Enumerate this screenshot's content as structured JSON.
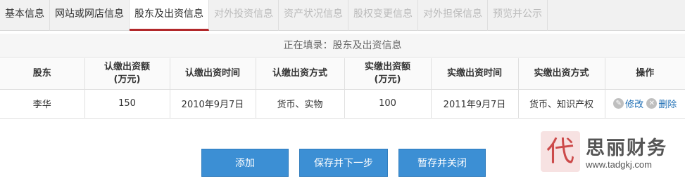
{
  "tabs": [
    {
      "label": "基本信息",
      "state": "done"
    },
    {
      "label": "网站或网店信息",
      "state": "done"
    },
    {
      "label": "股东及出资信息",
      "state": "active"
    },
    {
      "label": "对外投资信息",
      "state": "pending"
    },
    {
      "label": "资产状况信息",
      "state": "pending"
    },
    {
      "label": "股权变更信息",
      "state": "pending"
    },
    {
      "label": "对外担保信息",
      "state": "pending"
    },
    {
      "label": "预览并公示",
      "state": "pending"
    }
  ],
  "subtitle": "正在填录：股东及出资信息",
  "table": {
    "headers": [
      {
        "line1": "股东",
        "line2": ""
      },
      {
        "line1": "认缴出资额",
        "line2": "(万元)"
      },
      {
        "line1": "认缴出资时间",
        "line2": ""
      },
      {
        "line1": "认缴出资方式",
        "line2": ""
      },
      {
        "line1": "实缴出资额",
        "line2": "(万元)"
      },
      {
        "line1": "实缴出资时间",
        "line2": ""
      },
      {
        "line1": "实缴出资方式",
        "line2": ""
      },
      {
        "line1": "操作",
        "line2": ""
      }
    ],
    "rows": [
      {
        "shareholder": "李华",
        "subscribed_amount": "150",
        "subscribed_date": "2010年9月7日",
        "subscribed_method": "货币、实物",
        "paid_amount": "100",
        "paid_date": "2011年9月7日",
        "paid_method": "货币、知识产权",
        "edit_label": "修改",
        "delete_label": "删除"
      }
    ]
  },
  "buttons": {
    "add": "添加",
    "save_next": "保存并下一步",
    "save_close": "暂存并关闭"
  },
  "watermark": {
    "seal_char": "代",
    "name": "思丽财务",
    "url": "www.tadgkj.com"
  },
  "colors": {
    "accent": "#b2282b",
    "button": "#3c8fd4",
    "link": "#1f6fb5"
  }
}
